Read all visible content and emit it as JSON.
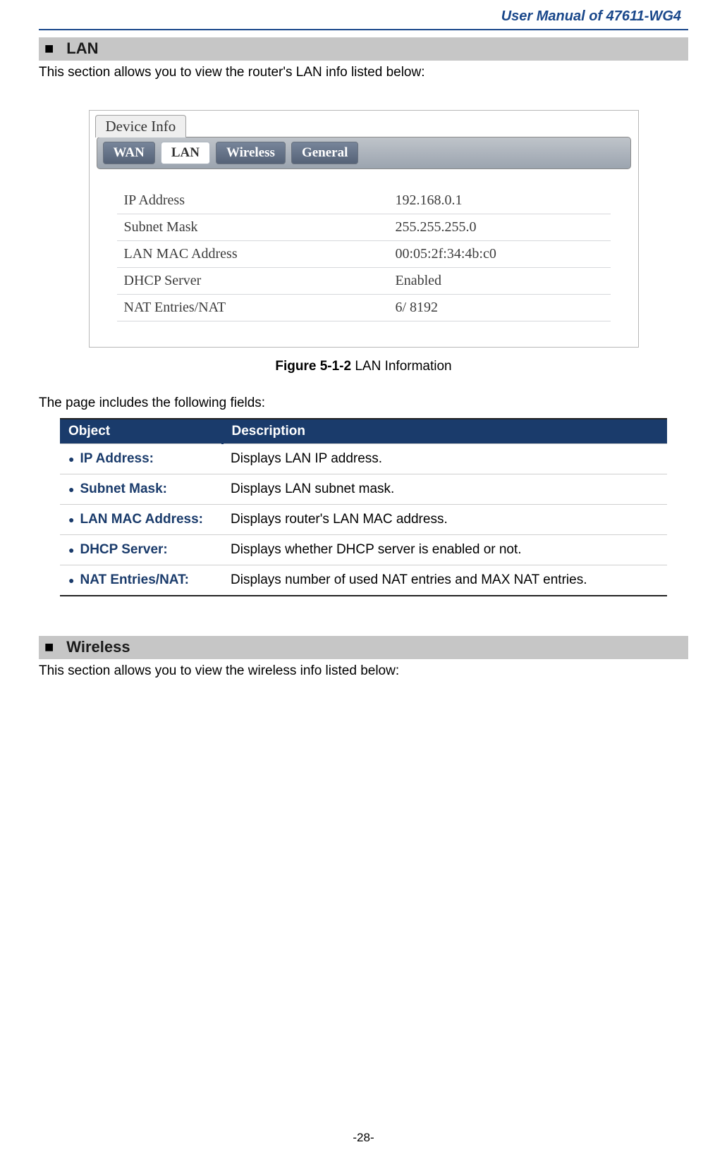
{
  "header": {
    "title": "User Manual of 47611-WG4"
  },
  "section_lan": {
    "bullet": "■",
    "title": "LAN",
    "intro": "This section allows you to view the router's LAN info listed below:"
  },
  "device_info": {
    "tab_label": "Device Info",
    "tabs": {
      "wan": "WAN",
      "lan": "LAN",
      "wireless": "Wireless",
      "general": "General"
    },
    "rows": [
      {
        "label": "IP Address",
        "value": "192.168.0.1"
      },
      {
        "label": "Subnet Mask",
        "value": "255.255.255.0"
      },
      {
        "label": "LAN MAC Address",
        "value": "00:05:2f:34:4b:c0"
      },
      {
        "label": "DHCP Server",
        "value": "Enabled"
      },
      {
        "label": "NAT Entries/NAT",
        "value": "6/ 8192"
      }
    ]
  },
  "figure_caption": {
    "bold": "Figure 5-1-2",
    "rest": " LAN Information"
  },
  "fields_intro": "The page includes the following fields:",
  "desc_table": {
    "headers": {
      "object": "Object",
      "description": "Description"
    },
    "rows": [
      {
        "object": "IP Address:",
        "description": "Displays LAN IP address."
      },
      {
        "object": "Subnet Mask:",
        "description": "Displays LAN subnet mask."
      },
      {
        "object": "LAN MAC Address:",
        "description": "Displays router's LAN MAC address."
      },
      {
        "object": "DHCP Server:",
        "description": "Displays whether DHCP server is enabled or not."
      },
      {
        "object": "NAT Entries/NAT:",
        "description": "Displays number of used NAT entries and MAX NAT entries."
      }
    ]
  },
  "section_wireless": {
    "bullet": "■",
    "title": "Wireless",
    "intro": "This section allows you to view the wireless info listed below:"
  },
  "page_number": "-28-"
}
